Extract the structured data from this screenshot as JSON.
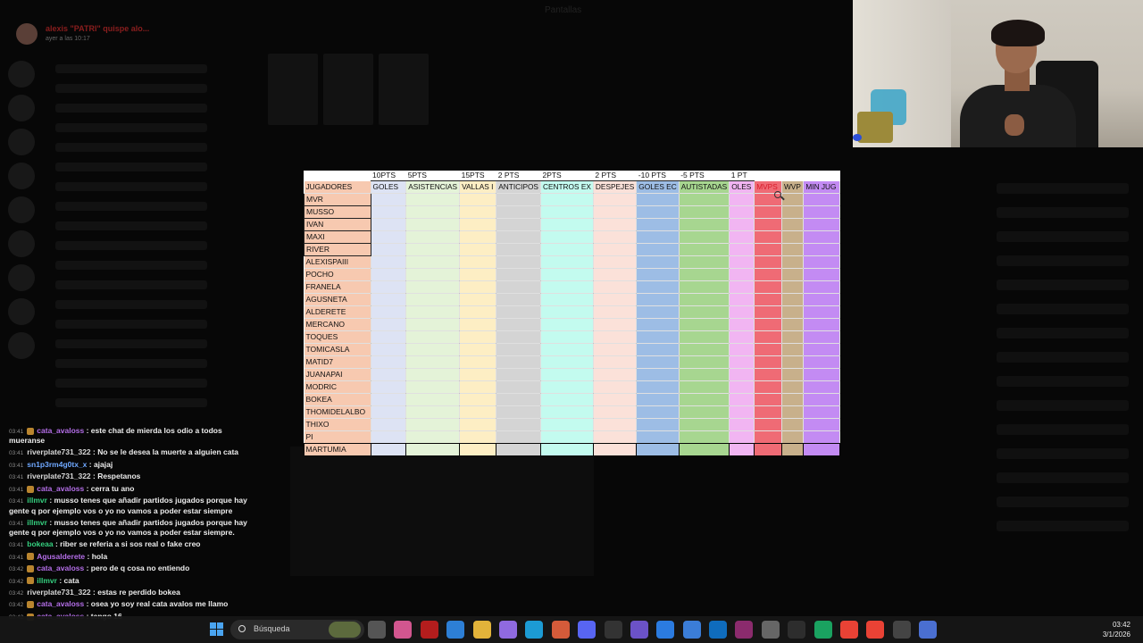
{
  "background": {
    "title": "Pantallas",
    "notice": {
      "user": "alexis \"PATRI\" quispe alo...",
      "time": "ayer a las 10:17"
    }
  },
  "sheet": {
    "points_row": [
      "",
      "10PTS",
      "5PTS",
      "15PTS",
      "2 PTS",
      "2PTS",
      "2 PTS",
      "-10 PTS",
      "-5 PTS",
      "1 PT",
      "",
      "",
      ""
    ],
    "headers": [
      "JUGADORES",
      "GOLES",
      "ASISTENCIAS",
      "VALLAS I",
      "ANTICIPOS",
      "CENTROS EX",
      "DESPEJES",
      "GOLES EC",
      "AUTISTADAS",
      "OLES",
      "MVPS",
      "WVP",
      "MIN JUG"
    ],
    "players": [
      "MVR",
      "MUSSO",
      "IVAN",
      "MAXI",
      "RIVER",
      "ALEXISPAIII",
      "POCHO",
      "FRANELA",
      "AGUSNETA",
      "ALDERETE",
      "MERCANO",
      "TOQUES",
      "TOMICASLA",
      "MATID7",
      "JUANAPAI",
      "MODRIC",
      "BOKEA",
      "THOMIDELALBO",
      "THIXO",
      "PI",
      "MARTUMIA"
    ],
    "column_colors": [
      "#f7c9b0",
      "#dde3f4",
      "#e4f3d8",
      "#fdeec4",
      "#d4d4d4",
      "#c3fbef",
      "#fbe1d9",
      "#9dbde5",
      "#a7d690",
      "#f1b5f2",
      "#ef6b75",
      "#c8b08b",
      "#c38bf3"
    ],
    "header_text_colors": [
      "#111111",
      "#111111",
      "#111111",
      "#111111",
      "#111111",
      "#111111",
      "#111111",
      "#111111",
      "#111111",
      "#111111",
      "#d81b2a",
      "#111111",
      "#111111"
    ]
  },
  "chat": [
    {
      "time": "03:41",
      "user": "cata_avaloss",
      "user_color": "#b46ee8",
      "badge": true,
      "text": "este chat de mierda los odio a todos mueranse"
    },
    {
      "time": "03:41",
      "user": "riverplate731_322",
      "user_color": "#d9d9d9",
      "badge": false,
      "text": "No se le desea la muerte a alguien cata"
    },
    {
      "time": "03:41",
      "user": "sn1p3rm4g0tx_x",
      "user_color": "#6fa8ff",
      "badge": false,
      "text": "ajajaj"
    },
    {
      "time": "03:41",
      "user": "riverplate731_322",
      "user_color": "#d9d9d9",
      "badge": false,
      "text": "Respetanos"
    },
    {
      "time": "03:41",
      "user": "cata_avaloss",
      "user_color": "#b46ee8",
      "badge": true,
      "text": "cerra tu ano"
    },
    {
      "time": "03:41",
      "user": "illmvr",
      "user_color": "#35d07f",
      "badge": false,
      "text": "musso tenes que añadir partidos jugados porque hay gente q por ejemplo vos o yo no vamos a poder estar siempre"
    },
    {
      "time": "03:41",
      "user": "illmvr",
      "user_color": "#35d07f",
      "badge": false,
      "text": "musso tenes que añadir partidos jugados porque hay gente q por ejemplo vos o yo no vamos a poder estar siempre."
    },
    {
      "time": "03:41",
      "user": "bokeaa",
      "user_color": "#35d07f",
      "badge": false,
      "text": "riber se referia a si sos real o fake creo"
    },
    {
      "time": "03:41",
      "user": "Agusalderete",
      "user_color": "#b46ee8",
      "badge": true,
      "text": "hola"
    },
    {
      "time": "03:42",
      "user": "cata_avaloss",
      "user_color": "#b46ee8",
      "badge": true,
      "text": "pero de q cosa no entiendo"
    },
    {
      "time": "03:42",
      "user": "illmvr",
      "user_color": "#35d07f",
      "badge": true,
      "text": "cata"
    },
    {
      "time": "03:42",
      "user": "riverplate731_322",
      "user_color": "#d9d9d9",
      "badge": false,
      "text": "estas re perdido bokea"
    },
    {
      "time": "03:42",
      "user": "cata_avaloss",
      "user_color": "#b46ee8",
      "badge": true,
      "text": "osea yo soy real cata avalos me llamo"
    },
    {
      "time": "03:42",
      "user": "cata_avaloss",
      "user_color": "#b46ee8",
      "badge": true,
      "text": "tengo 16"
    }
  ],
  "taskbar": {
    "search_placeholder": "Búsqueda",
    "time": "03:42",
    "date": "3/1/2026",
    "icons": [
      {
        "name": "task-view-icon",
        "color": "#555555"
      },
      {
        "name": "copilot-icon",
        "color": "#d2568f"
      },
      {
        "name": "opera-icon",
        "color": "#b31d1d"
      },
      {
        "name": "store-icon",
        "color": "#2d7fd6"
      },
      {
        "name": "folder-icon",
        "color": "#e2b33a"
      },
      {
        "name": "pen-icon",
        "color": "#8f6ae0"
      },
      {
        "name": "edge-icon",
        "color": "#1c9bd4"
      },
      {
        "name": "vivaldi-icon",
        "color": "#d45b3a"
      },
      {
        "name": "discord-icon",
        "color": "#5865f2"
      },
      {
        "name": "ccleaner-icon",
        "color": "#333333"
      },
      {
        "name": "apps-icon",
        "color": "#6b52c7"
      },
      {
        "name": "pencil-blue-icon",
        "color": "#2b7be0"
      },
      {
        "name": "notepad-icon",
        "color": "#3b7dd8"
      },
      {
        "name": "outlook-icon",
        "color": "#0f6cbd"
      },
      {
        "name": "winrar-icon",
        "color": "#8b2b6d"
      },
      {
        "name": "settings-icon",
        "color": "#666666"
      },
      {
        "name": "terminal-icon",
        "color": "#2d2d2d"
      },
      {
        "name": "browser-green-icon",
        "color": "#1aa260"
      },
      {
        "name": "chrome-icon",
        "color": "#e94235"
      },
      {
        "name": "chrome-2-icon",
        "color": "#e94235"
      },
      {
        "name": "obs-icon",
        "color": "#444444"
      },
      {
        "name": "calculator-icon",
        "color": "#4a6fd1"
      }
    ]
  }
}
